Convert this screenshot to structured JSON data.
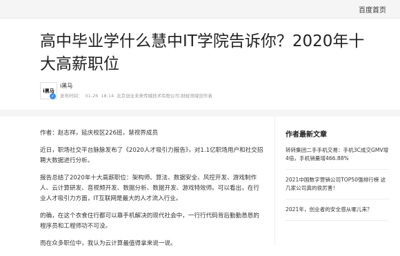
{
  "topbar": {
    "home_link": "百度首页"
  },
  "article": {
    "title": "高中毕业学什么慧中IT学院告诉你？2020年十大高薪职位",
    "author": {
      "logo_text": "i黑马",
      "name": "i黑马",
      "publish_label": "发布时间：",
      "date": "01-26",
      "time": "18:14",
      "org": "北京创业未来传媒技术有限公司,财经领域创作者"
    },
    "paragraphs": [
      "作者：赵志祥，延庆校区226班，慧视界成员",
      "近日，职场社交平台脉脉发布了《2020人才吸引力报告》，对1.1亿职场用户和社交招聘大数据进行分析。",
      "报告总结了2020年十大高薪职位：架构师、算法、数据安全、风控开发、游戏制作人、云计算研发、音视频开发、数据分析、数据开发、游戏特效师。可以看出，在行业人才吸引力方面，IT互联网是最大的人才流入行业。",
      "的确，在这个衣食住行都可以靠手机解决的现代社会中，一行行代码背后勤勤恳恳的程序员和工程师功不可没。",
      "而在众多职位中，我认为云计算最值得拿来说一说。"
    ]
  },
  "sidebar": {
    "heading": "作者最新文章",
    "items": [
      "转转集团二手手机交易：手机3C成交GMV增4倍，手机销量增466.88%",
      "2021中国数字营销公司TOP50强排行榜 这几家公司真的很厉害！",
      "2021年，创业者的安全感从哪儿来？"
    ]
  }
}
